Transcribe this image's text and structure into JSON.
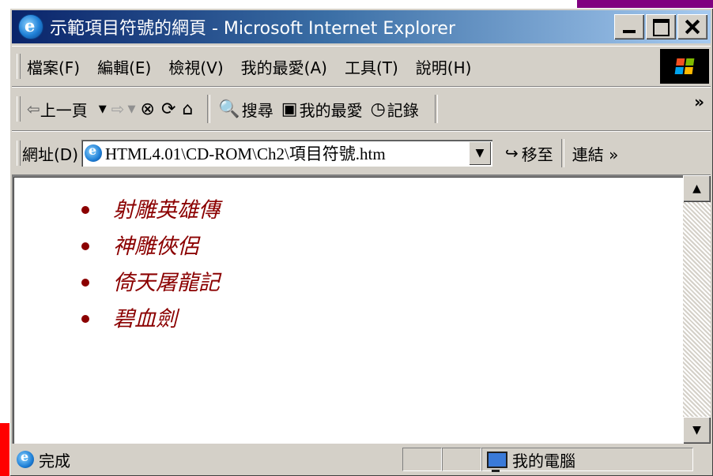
{
  "window": {
    "title": "示範項目符號的網頁 - Microsoft Internet Explorer"
  },
  "menubar": {
    "items": [
      "檔案(F)",
      "編輯(E)",
      "檢視(V)",
      "我的最愛(A)",
      "工具(T)",
      "說明(H)"
    ]
  },
  "toolbar": {
    "back_label": "上一頁",
    "search_label": "搜尋",
    "favorites_label": "我的最愛",
    "history_label": "記錄",
    "more_chevron": "»"
  },
  "addressbar": {
    "label": "網址(D)",
    "url": "HTML4.01\\CD-ROM\\Ch2\\項目符號.htm",
    "go_label": "移至",
    "links_label": "連結 »"
  },
  "content": {
    "list_color": "#8b0000",
    "items": [
      "射雕英雄傳",
      "神雕俠侶",
      "倚天屠龍記",
      "碧血劍"
    ]
  },
  "statusbar": {
    "status_text": "完成",
    "zone_label": "我的電腦"
  },
  "colors": {
    "titlebar_start": "#0a246a",
    "titlebar_end": "#a6caf0",
    "chrome_gray": "#d4d0c8",
    "corner_purple": "#800080",
    "corner_red": "#ff0000"
  }
}
